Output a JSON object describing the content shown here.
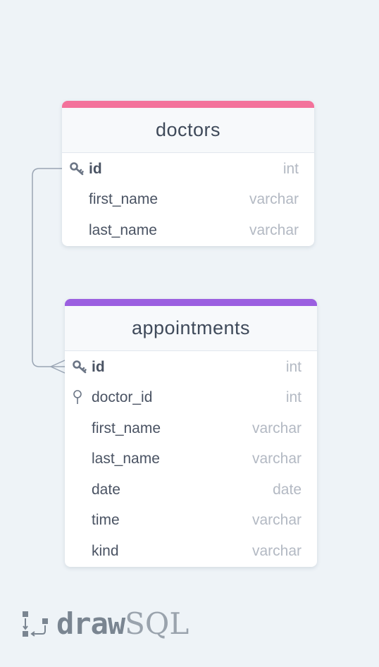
{
  "colors": {
    "doctors_accent": "#f3729b",
    "appointments_accent": "#9b5fe0",
    "connector": "#9aa5b4"
  },
  "tables": [
    {
      "name": "doctors",
      "fields": [
        {
          "name": "id",
          "type": "int",
          "icon": "key-icon",
          "bold": true
        },
        {
          "name": "first_name",
          "type": "varchar"
        },
        {
          "name": "last_name",
          "type": "varchar"
        }
      ]
    },
    {
      "name": "appointments",
      "fields": [
        {
          "name": "id",
          "type": "int",
          "icon": "key-icon",
          "bold": true
        },
        {
          "name": "doctor_id",
          "type": "int",
          "icon": "foreign-key-icon"
        },
        {
          "name": "first_name",
          "type": "varchar"
        },
        {
          "name": "last_name",
          "type": "varchar"
        },
        {
          "name": "date",
          "type": "date"
        },
        {
          "name": "time",
          "type": "varchar"
        },
        {
          "name": "kind",
          "type": "varchar"
        }
      ]
    }
  ],
  "relationship": {
    "from": "doctors.id",
    "to": "appointments.id",
    "cardinality": "one-to-many"
  },
  "logo": {
    "part1": "draw",
    "part2": "SQL"
  }
}
